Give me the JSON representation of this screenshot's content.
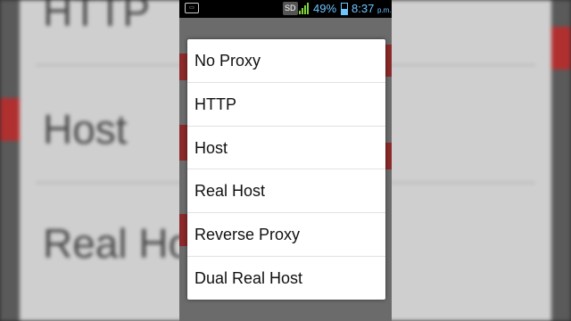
{
  "background_blurred": {
    "top_text": "HTTP",
    "middle_text": "Host",
    "bottom_text": "Real Ho"
  },
  "statusbar": {
    "sd_label": "SD",
    "battery_percent": "49%",
    "time": "8:37",
    "ampm": "p.m.",
    "colors": {
      "accent": "#6ec6ff",
      "signal": "#7fd43a"
    }
  },
  "proxy_menu": {
    "options": [
      {
        "label": "No Proxy"
      },
      {
        "label": "HTTP"
      },
      {
        "label": "Host"
      },
      {
        "label": "Real Host"
      },
      {
        "label": "Reverse Proxy"
      },
      {
        "label": "Dual Real Host"
      }
    ]
  }
}
